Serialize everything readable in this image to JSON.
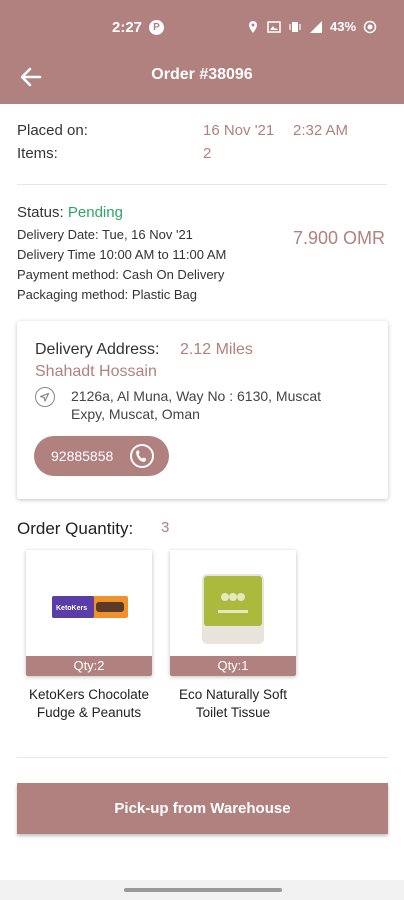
{
  "status_bar": {
    "time": "2:27",
    "p_badge": "P",
    "battery": "43%"
  },
  "header": {
    "title": "Order #38096",
    "back_icon": "arrow-left-icon"
  },
  "order": {
    "placed_label": "Placed on:",
    "placed_date": "16 Nov '21",
    "placed_time": "2:32 AM",
    "items_label": "Items:",
    "items_value": "2"
  },
  "status": {
    "status_label": "Status:",
    "status_value": "Pending",
    "delivery_date_label": "Delivery Date:",
    "delivery_date_value": "Tue, 16 Nov '21",
    "delivery_time_label": "Delivery Time",
    "delivery_time_value": "10:00 AM to 11:00 AM",
    "payment_label": "Payment method:",
    "payment_value": "Cash On Delivery",
    "packaging_label": "Packaging method:",
    "packaging_value": "Plastic Bag",
    "amount": "7.900 OMR"
  },
  "delivery": {
    "label": "Delivery Address:",
    "distance": "2.12 Miles",
    "customer": "Shahadt Hossain",
    "address": "2126a, Al Muna, Way No : 6130, Muscat Expy, Muscat, Oman",
    "phone": "92885858"
  },
  "quantity": {
    "label": "Order Quantity:",
    "value": "3"
  },
  "products": [
    {
      "name": "KetoKers Chocolate Fudge & Peanuts",
      "qty": "Qty:2",
      "brand": "KetoKers"
    },
    {
      "name": "Eco Naturally Soft Toilet Tissue",
      "qty": "Qty:1"
    }
  ],
  "action": {
    "label": "Pick-up from Warehouse"
  },
  "colors": {
    "accent": "#b0817f",
    "pending": "#2ea66a"
  }
}
